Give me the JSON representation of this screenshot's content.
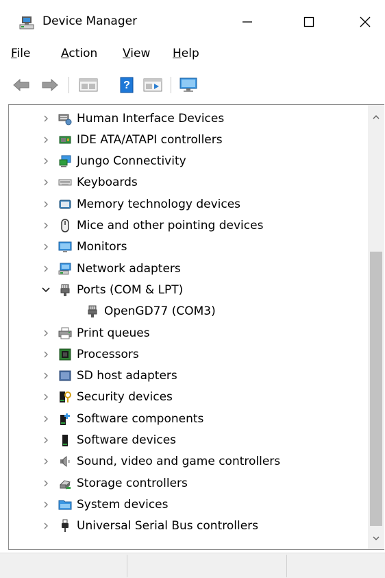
{
  "window": {
    "title": "Device Manager",
    "minimize_glyph": "—",
    "maximize_glyph": "☐",
    "close_glyph": "✕"
  },
  "menu": [
    {
      "label": "File",
      "accel": "F",
      "rest": "ile"
    },
    {
      "label": "Action",
      "accel": "A",
      "rest": "ction"
    },
    {
      "label": "View",
      "accel": "V",
      "rest": "iew"
    },
    {
      "label": "Help",
      "accel": "H",
      "rest": "elp"
    }
  ],
  "toolbar": {
    "icons": [
      "back-icon",
      "forward-icon",
      "properties-icon",
      "help-icon",
      "update-driver-icon",
      "computer-icon"
    ]
  },
  "tree": {
    "items": [
      {
        "label": "Human Interface Devices",
        "icon": "hid-icon",
        "expanded": false,
        "level": 0
      },
      {
        "label": "IDE ATA/ATAPI controllers",
        "icon": "ide-icon",
        "expanded": false,
        "level": 0
      },
      {
        "label": "Jungo Connectivity",
        "icon": "jungo-icon",
        "expanded": false,
        "level": 0
      },
      {
        "label": "Keyboards",
        "icon": "keyboard-icon",
        "expanded": false,
        "level": 0
      },
      {
        "label": "Memory technology devices",
        "icon": "memory-icon",
        "expanded": false,
        "level": 0
      },
      {
        "label": "Mice and other pointing devices",
        "icon": "mouse-icon",
        "expanded": false,
        "level": 0
      },
      {
        "label": "Monitors",
        "icon": "monitor-icon",
        "expanded": false,
        "level": 0
      },
      {
        "label": "Network adapters",
        "icon": "network-icon",
        "expanded": false,
        "level": 0
      },
      {
        "label": "Ports (COM & LPT)",
        "icon": "port-icon",
        "expanded": true,
        "level": 0
      },
      {
        "label": "OpenGD77 (COM3)",
        "icon": "port-icon",
        "expanded": null,
        "level": 1
      },
      {
        "label": "Print queues",
        "icon": "printer-icon",
        "expanded": false,
        "level": 0
      },
      {
        "label": "Processors",
        "icon": "processor-icon",
        "expanded": false,
        "level": 0
      },
      {
        "label": "SD host adapters",
        "icon": "sd-icon",
        "expanded": false,
        "level": 0
      },
      {
        "label": "Security devices",
        "icon": "security-icon",
        "expanded": false,
        "level": 0
      },
      {
        "label": "Software components",
        "icon": "software-component-icon",
        "expanded": false,
        "level": 0
      },
      {
        "label": "Software devices",
        "icon": "software-device-icon",
        "expanded": false,
        "level": 0
      },
      {
        "label": "Sound, video and game controllers",
        "icon": "sound-icon",
        "expanded": false,
        "level": 0
      },
      {
        "label": "Storage controllers",
        "icon": "storage-icon",
        "expanded": false,
        "level": 0
      },
      {
        "label": "System devices",
        "icon": "system-icon",
        "expanded": false,
        "level": 0
      },
      {
        "label": "Universal Serial Bus controllers",
        "icon": "usb-icon",
        "expanded": false,
        "level": 0
      }
    ]
  },
  "colors": {
    "scroll_thumb": "#c2c2c2",
    "status_bar": "#f0f0f0",
    "accent_blue": "#1e78d7"
  }
}
